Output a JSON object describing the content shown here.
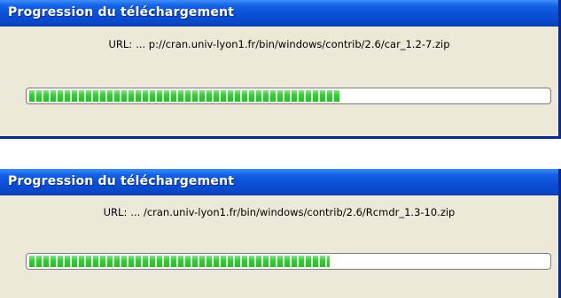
{
  "dialogs": [
    {
      "title": "Progression du téléchargement",
      "url_label": "URL:",
      "url_text": "... p://cran.univ-lyon1.fr/bin/windows/contrib/2.6/car_1.2-7.zip",
      "progress": 0.6
    },
    {
      "title": "Progression du téléchargement",
      "url_label": "URL:",
      "url_text": "... /cran.univ-lyon1.fr/bin/windows/contrib/2.6/Rcmdr_1.3-10.zip",
      "progress": 0.58
    }
  ],
  "colors": {
    "titlebar": "#0b4fd6",
    "dialog_background": "#ece9d8",
    "progress_segment": "#2bd12b"
  }
}
